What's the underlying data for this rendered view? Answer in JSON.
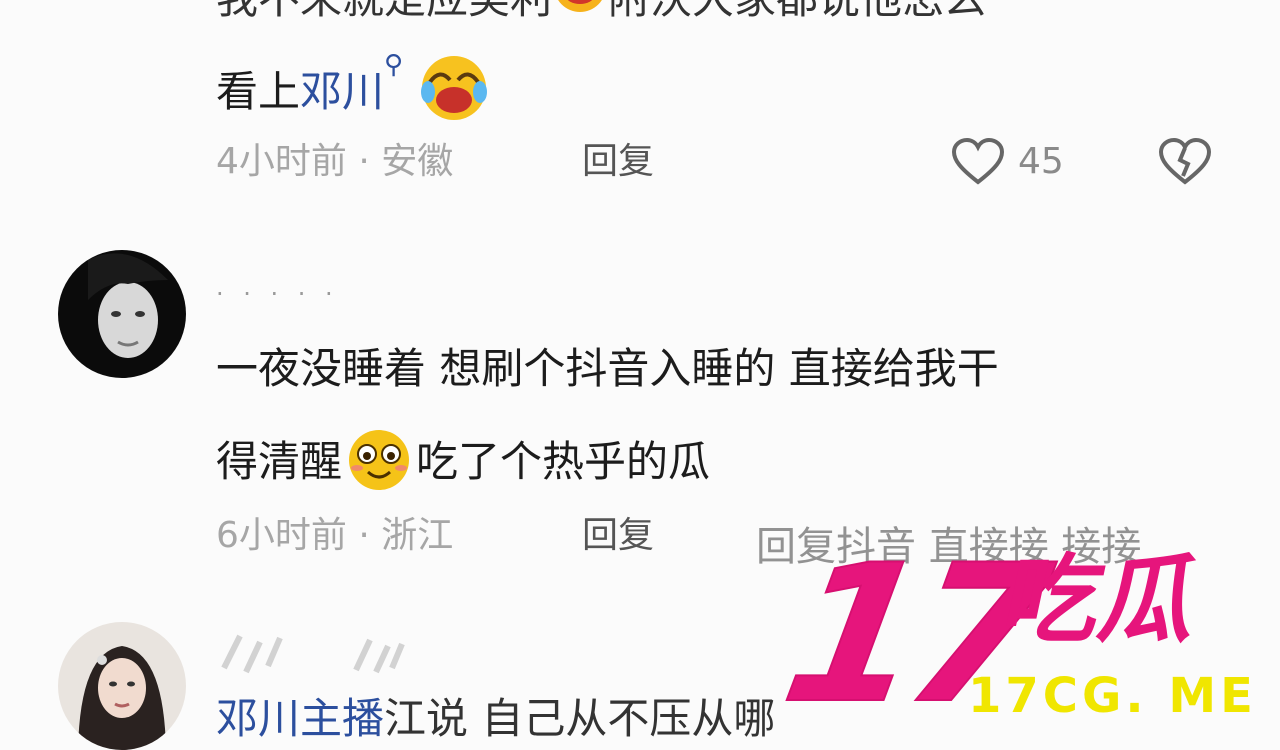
{
  "comments": [
    {
      "text_line1_visible": "我不来就是应美利",
      "text_line1_tail": "附沃大家都说他怎么",
      "text_line2_prefix": "看上",
      "text_line2_link": "邓川",
      "meta": "4小时前 · 安徽",
      "reply_label": "回复",
      "like_count": "45",
      "emoji": "laugh-cry-emoji"
    },
    {
      "username": "· · · · ·",
      "text_line1": "一夜没睡着 想刷个抖音入睡的 直接给我干",
      "text_line2_prefix": "得清醒",
      "text_line2_suffix": "吃了个热乎的瓜",
      "meta": "6小时前 · 浙江",
      "reply_label": "回复",
      "ghost_text": "回复抖音 直接接 接接",
      "emoji": "grin-emoji"
    },
    {
      "text_partial": "邓川主播",
      "text_partial_tail": "江说 自己从不压从哪"
    }
  ],
  "watermark": {
    "number": "17",
    "chinese": "吃瓜",
    "url": "17CG. ME"
  },
  "colors": {
    "brand_pink": "#e6157c",
    "url_yellow": "#f0e600",
    "link_blue": "#2c4f9e"
  }
}
